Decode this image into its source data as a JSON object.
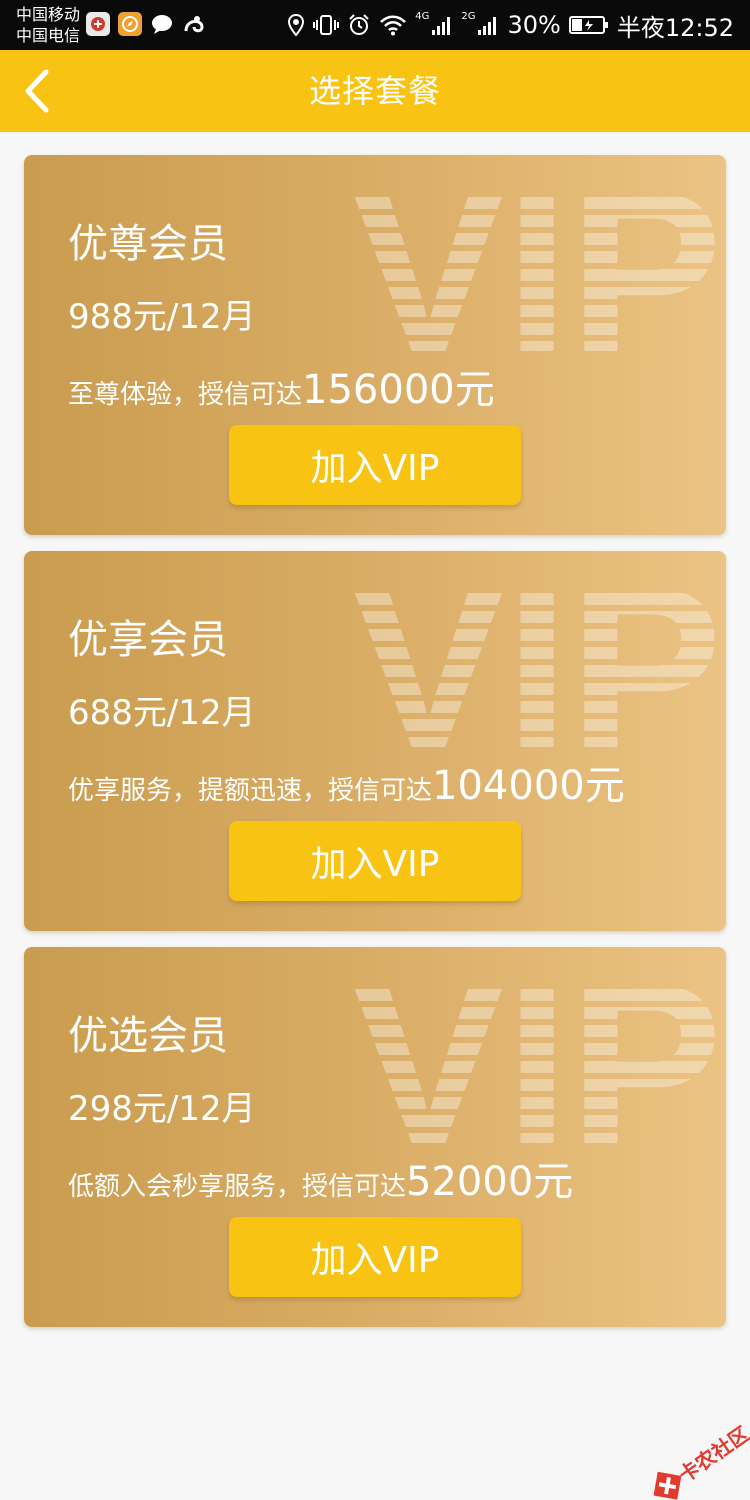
{
  "status_bar": {
    "carrier_1": "中国移动",
    "carrier_2": "中国电信",
    "net_4g": "4G",
    "net_2g": "2G",
    "battery": "30%",
    "time": "半夜12:52"
  },
  "header": {
    "title": "选择套餐"
  },
  "plans": [
    {
      "name": "优尊会员",
      "price": "988元/12月",
      "desc": "至尊体验，授信可达",
      "amount": "156000元",
      "button_label": "加入VIP",
      "watermark": "VIP"
    },
    {
      "name": "优享会员",
      "price": "688元/12月",
      "desc": "优享服务，提额迅速，授信可达",
      "amount": "104000元",
      "button_label": "加入VIP",
      "watermark": "VIP"
    },
    {
      "name": "优选会员",
      "price": "298元/12月",
      "desc": "低额入会秒享服务，授信可达",
      "amount": "52000元",
      "button_label": "加入VIP",
      "watermark": "VIP"
    }
  ],
  "corner_watermark": "卡农社区",
  "colors": {
    "accent": "#f8c313",
    "card_start": "#c99c4f",
    "card_end": "#ebc383",
    "background": "#f7f7f7"
  }
}
